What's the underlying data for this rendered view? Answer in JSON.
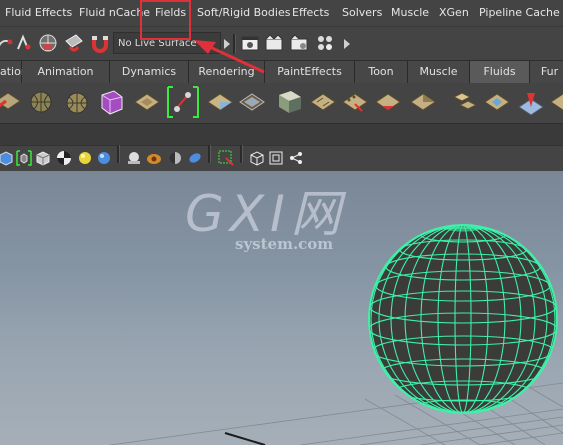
{
  "menubar": {
    "items": [
      "Fluid Effects",
      "Fluid nCache",
      "Fields",
      "Soft/Rigid Bodies",
      "Effects",
      "Solvers",
      "Muscle",
      "XGen",
      "Pipeline Cache"
    ]
  },
  "toolbar": {
    "live_surface": "No Live Surface"
  },
  "shelf_tabs": [
    "ation",
    "Animation",
    "Dynamics",
    "Rendering",
    "PaintEffects",
    "Toon",
    "Muscle",
    "Fluids",
    "Fur"
  ],
  "watermark": {
    "brand": "GXI网",
    "sub": "system.com"
  },
  "colors": {
    "highlight": "#e0303a",
    "wire": "#3ff0a8",
    "sphere": "#3a3b3a"
  },
  "icons": {
    "toolbar": [
      "snap-curve-icon",
      "snap-point-icon",
      "snap-view-icon",
      "make-live-icon",
      "render-frame-icon",
      "ipr-render-icon",
      "render-settings-icon",
      "hypershade-icon"
    ],
    "shelf": [
      "fluid-container-icon",
      "fluid-3d-icon",
      "ocean-icon",
      "pond-icon",
      "fluid-box-icon",
      "emit-fluid-icon",
      "fluid-nucleus-icon",
      "fluid-plane-icon",
      "fluid-2d-icon",
      "fluid-solid-icon",
      "fluid-field-icon",
      "fluid-texture-icon",
      "fluid-gradient-icon",
      "fluid-cache-icon",
      "fluid-emitter-icon",
      "fluid-flame-icon"
    ],
    "viewport": [
      "cube-shaded-icon",
      "wireframe-on-shaded-icon",
      "cube-xray-icon",
      "checker-icon",
      "light-icon",
      "sphere-icon",
      "smooth-icon",
      "camera-icon",
      "lights-icon",
      "shadows-icon",
      "ao-icon",
      "isolate-icon",
      "isolate-select-icon",
      "xray-icon",
      "grid-icon",
      "share-icon"
    ]
  }
}
